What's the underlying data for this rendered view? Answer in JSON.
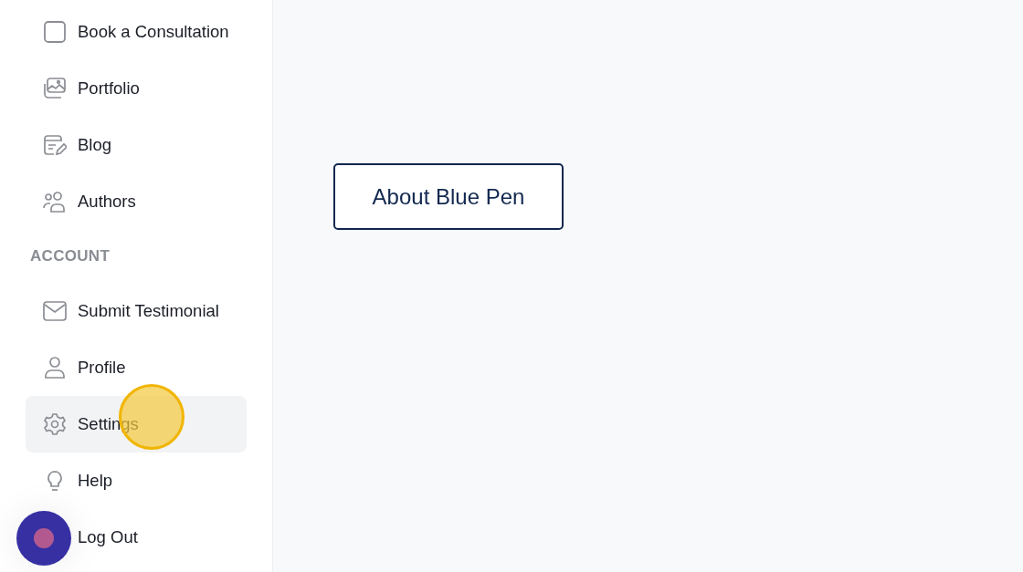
{
  "sidebar": {
    "groups": [
      {
        "items": [
          {
            "label": "Book a Consultation",
            "selected": false
          },
          {
            "label": "Portfolio",
            "selected": false
          },
          {
            "label": "Blog",
            "selected": false
          },
          {
            "label": "Authors",
            "selected": false
          }
        ]
      },
      {
        "heading": "ACCOUNT",
        "items": [
          {
            "label": "Submit Testimonial",
            "selected": false
          },
          {
            "label": "Profile",
            "selected": false
          },
          {
            "label": "Settings",
            "selected": true
          },
          {
            "label": "Help",
            "selected": false
          },
          {
            "label": "Log Out",
            "selected": false
          }
        ]
      }
    ]
  },
  "main": {
    "button": "About Blue Pen"
  }
}
